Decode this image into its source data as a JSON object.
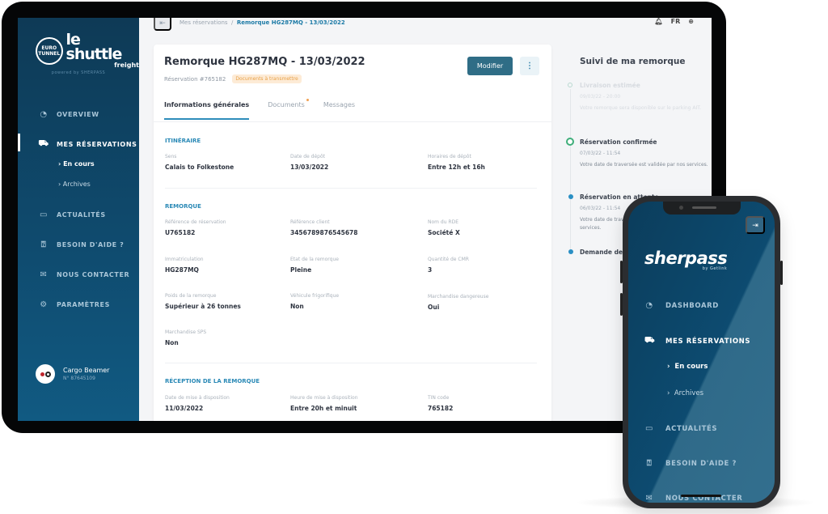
{
  "sidebar": {
    "logo_circle_top": "EURO",
    "logo_circle_bottom": "TUNNEL",
    "logo_main": "le shuttle",
    "logo_sub": "freight",
    "powered_by": "powered by SHERPASS",
    "items": [
      {
        "label": "OVERVIEW",
        "icon": "gauge-icon"
      },
      {
        "label": "MES RÉSERVATIONS",
        "icon": "truck-icon",
        "active": true
      },
      {
        "label": "ACTUALITÉS",
        "icon": "chat-icon"
      },
      {
        "label": "BESOIN D'AIDE ?",
        "icon": "help-icon"
      },
      {
        "label": "NOUS CONTACTER",
        "icon": "mail-icon"
      },
      {
        "label": "PARAMÈTRES",
        "icon": "gear-icon"
      }
    ],
    "sub_items": [
      {
        "label": "En cours",
        "active": true
      },
      {
        "label": "Archives"
      }
    ],
    "user": {
      "name": "Cargo Beamer",
      "number": "N° 87645109"
    }
  },
  "topbar": {
    "breadcrumb": [
      "Mes réservations",
      "Remorque HG287MQ - 13/03/2022"
    ],
    "separator": "/",
    "language": "FR"
  },
  "card": {
    "title": "Remorque HG287MQ - 13/03/2022",
    "reservation": "Réservation #765182",
    "badge": "Documents à transmettre",
    "modify_label": "Modifier",
    "more_label": "⋮",
    "tabs": [
      {
        "label": "Informations générales",
        "active": true
      },
      {
        "label": "Documents",
        "has_dot": true
      },
      {
        "label": "Messages"
      }
    ],
    "sections": [
      {
        "title": "ITINÉRAIRE",
        "fields": [
          {
            "label": "Sens",
            "value": "Calais to Folkestone"
          },
          {
            "label": "Date de dépôt",
            "value": "13/03/2022"
          },
          {
            "label": "Horaires de dépôt",
            "value": "Entre 12h et 16h"
          }
        ]
      },
      {
        "title": "REMORQUE",
        "fields": [
          {
            "label": "Référence de réservation",
            "value": "U765182"
          },
          {
            "label": "Référence client",
            "value": "3456789876545678"
          },
          {
            "label": "Nom du RDE",
            "value": "Société X"
          },
          {
            "label": "Immatriculation",
            "value": "HG287MQ"
          },
          {
            "label": "Etat de la remorque",
            "value": "Pleine"
          },
          {
            "label": "Quantité de CMR",
            "value": "3"
          },
          {
            "label": "Poids de la remorque",
            "value": "Supérieur à 26 tonnes"
          },
          {
            "label": "Véhicule frigorifique",
            "value": "Non"
          },
          {
            "label": "Marchandise dangereuse",
            "value": "Oui"
          },
          {
            "label": "Marchandise SPS",
            "value": "Non"
          }
        ]
      },
      {
        "title": "RÉCEPTION DE LA REMORQUE",
        "fields": [
          {
            "label": "Date de mise à disposition",
            "value": "11/03/2022"
          },
          {
            "label": "Heure de mise à disposition",
            "value": "Entre 20h et minuit"
          },
          {
            "label": "TIN code",
            "value": "765182"
          }
        ]
      }
    ]
  },
  "tracking": {
    "title": "Suivi de ma remorque",
    "events": [
      {
        "title": "Livraison estimée",
        "date": "09/03/22 - 20:00",
        "desc": "Votre remorque sera disponible sur le parking AIT.",
        "state": "future"
      },
      {
        "title": "Réservation  confirmée",
        "date": "07/03/22 - 11:54",
        "desc": "Votre date de traversée est validée par nos services.",
        "state": "current"
      },
      {
        "title": "Réservation en attente",
        "date": "06/03/22 - 11:54",
        "desc": "Votre date de traversée est en cours d'étude par nos services.",
        "state": "done"
      },
      {
        "title": "Demande de réservation",
        "state": "done"
      }
    ]
  },
  "phone": {
    "brand": "sherpass",
    "brand_by": "by Getlink",
    "items": [
      {
        "label": "DASHBOARD"
      },
      {
        "label": "MES RÉSERVATIONS",
        "active": true
      },
      {
        "label": "ACTUALITÉS"
      },
      {
        "label": "BESOIN D'AIDE ?"
      },
      {
        "label": "NOUS CONTACTER"
      }
    ],
    "sub_items": [
      {
        "label": "En cours",
        "active": true
      },
      {
        "label": "Archives"
      }
    ]
  },
  "colors": {
    "sidebar": "#0f4c70",
    "accent": "#2a89b6",
    "button": "#2f6d86",
    "badge_bg": "#fdebd6",
    "badge_text": "#e8a046",
    "confirmed": "#3fae7a"
  }
}
